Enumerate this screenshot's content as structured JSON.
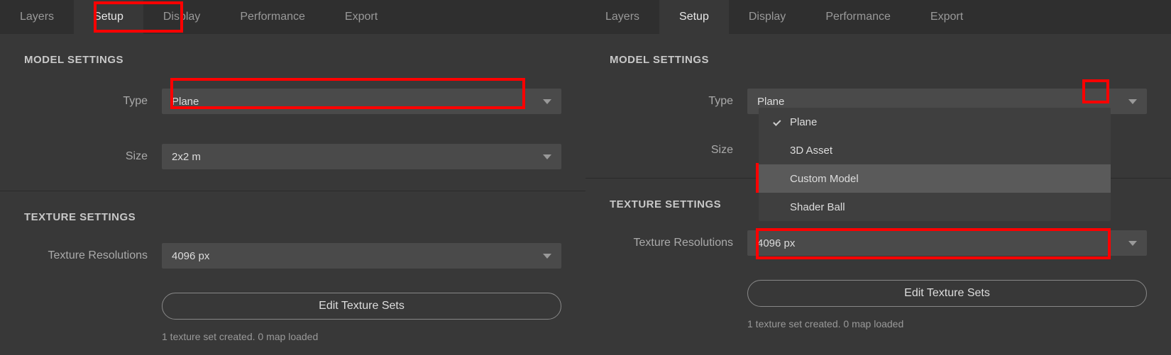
{
  "tabs": {
    "layers": "Layers",
    "setup": "Setup",
    "display": "Display",
    "performance": "Performance",
    "export": "Export"
  },
  "sections": {
    "model": "MODEL SETTINGS",
    "texture": "TEXTURE SETTINGS"
  },
  "labels": {
    "type": "Type",
    "size": "Size",
    "texres": "Texture Resolutions"
  },
  "values": {
    "type": "Plane",
    "size": "2x2 m",
    "texres": "4096 px"
  },
  "dropdown": {
    "plane": "Plane",
    "asset3d": "3D Asset",
    "custom": "Custom Model",
    "shader": "Shader Ball"
  },
  "buttons": {
    "editsets": "Edit Texture Sets"
  },
  "status": "1 texture set created. 0 map loaded"
}
